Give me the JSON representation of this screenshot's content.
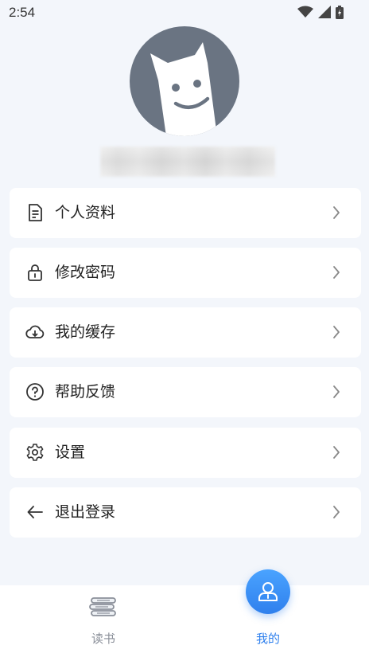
{
  "status": {
    "time": "2:54",
    "icons": [
      "wifi-icon",
      "signal-icon",
      "battery-icon"
    ]
  },
  "profile": {
    "avatar": "cat-avatar-icon"
  },
  "menu": [
    {
      "label": "个人资料",
      "icon": "document-icon"
    },
    {
      "label": "修改密码",
      "icon": "lock-icon"
    },
    {
      "label": "我的缓存",
      "icon": "cloud-download-icon"
    },
    {
      "label": "帮助反馈",
      "icon": "help-circle-icon"
    },
    {
      "label": "设置",
      "icon": "gear-icon"
    },
    {
      "label": "退出登录",
      "icon": "arrow-left-icon"
    }
  ],
  "bottom_nav": {
    "reading_label": "读书",
    "mine_label": "我的"
  },
  "colors": {
    "accent": "#2f80ed",
    "background": "#f3f6fb",
    "avatar_bg": "#6a7482",
    "inactive": "#8a8f99"
  }
}
